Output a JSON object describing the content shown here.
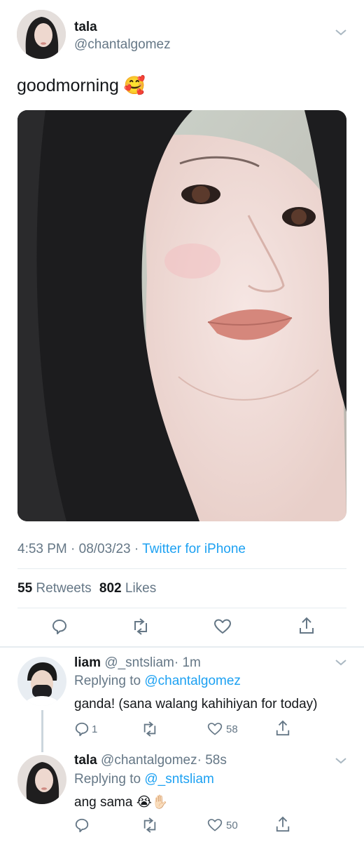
{
  "tweet": {
    "display_name": "tala",
    "handle": "@chantalgomez",
    "text": "goodmorning",
    "text_emoji": "🥰",
    "time": "4:53 PM · 08/03/23 · ",
    "source": "Twitter for iPhone",
    "retweets_count": "55",
    "retweets_label": "Retweets",
    "likes_count": "802",
    "likes_label": "Likes"
  },
  "replies": [
    {
      "display_name": "liam",
      "handle": "@_sntsliam",
      "age": "· 1m",
      "replying_label": "Replying to",
      "replying_to": "@chantalgomez",
      "text": "ganda! (sana walang kahihiyan for today)",
      "reply_count": "1",
      "like_count": "58"
    },
    {
      "display_name": "tala",
      "handle": "@chantalgomez",
      "age": "· 58s",
      "replying_label": "Replying to",
      "replying_to": "@_sntsliam",
      "text": "ang sama",
      "text_emoji": "😭✋🏻",
      "reply_count": "",
      "like_count": "50"
    }
  ],
  "icons": [
    "reply-icon",
    "retweet-icon",
    "like-icon",
    "share-icon",
    "chevron-down-icon"
  ],
  "colors": {
    "accent": "#1da1f2",
    "secondary_text": "#657786",
    "divider": "#e6ecf0"
  }
}
